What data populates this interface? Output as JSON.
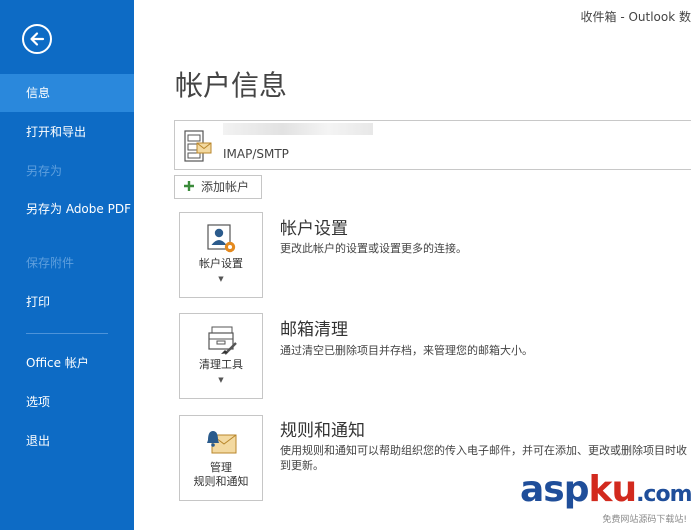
{
  "window": {
    "title": "收件箱 - Outlook 数"
  },
  "sidebar": {
    "items": [
      {
        "label": "信息"
      },
      {
        "label": "打开和导出"
      },
      {
        "label": "另存为"
      },
      {
        "label": "另存为 Adobe PDF"
      },
      {
        "label": "保存附件"
      },
      {
        "label": "打印"
      },
      {
        "label": "Office 帐户"
      },
      {
        "label": "选项"
      },
      {
        "label": "退出"
      }
    ]
  },
  "main": {
    "title": "帐户信息",
    "account": {
      "type": "IMAP/SMTP"
    },
    "add_account": "添加帐户",
    "sections": [
      {
        "button": "帐户设置",
        "title": "帐户设置",
        "desc": "更改此帐户的设置或设置更多的连接。"
      },
      {
        "button": "清理工具",
        "title": "邮箱清理",
        "desc": "通过清空已删除项目并存档，来管理您的邮箱大小。"
      },
      {
        "button_line1": "管理",
        "button_line2": "规则和通知",
        "title": "规则和通知",
        "desc": "使用规则和通知可以帮助组织您的传入电子邮件，并可在添加、更改或删除项目时收到更新。"
      }
    ]
  },
  "watermark": {
    "text_a": "asp",
    "text_b": "ku",
    "text_c": ".com",
    "sub": "免费网站源码下载站!"
  },
  "colors": {
    "sidebar": "#0d6bc5",
    "selected": "#2a88dc",
    "accent": "#d77b1c"
  }
}
